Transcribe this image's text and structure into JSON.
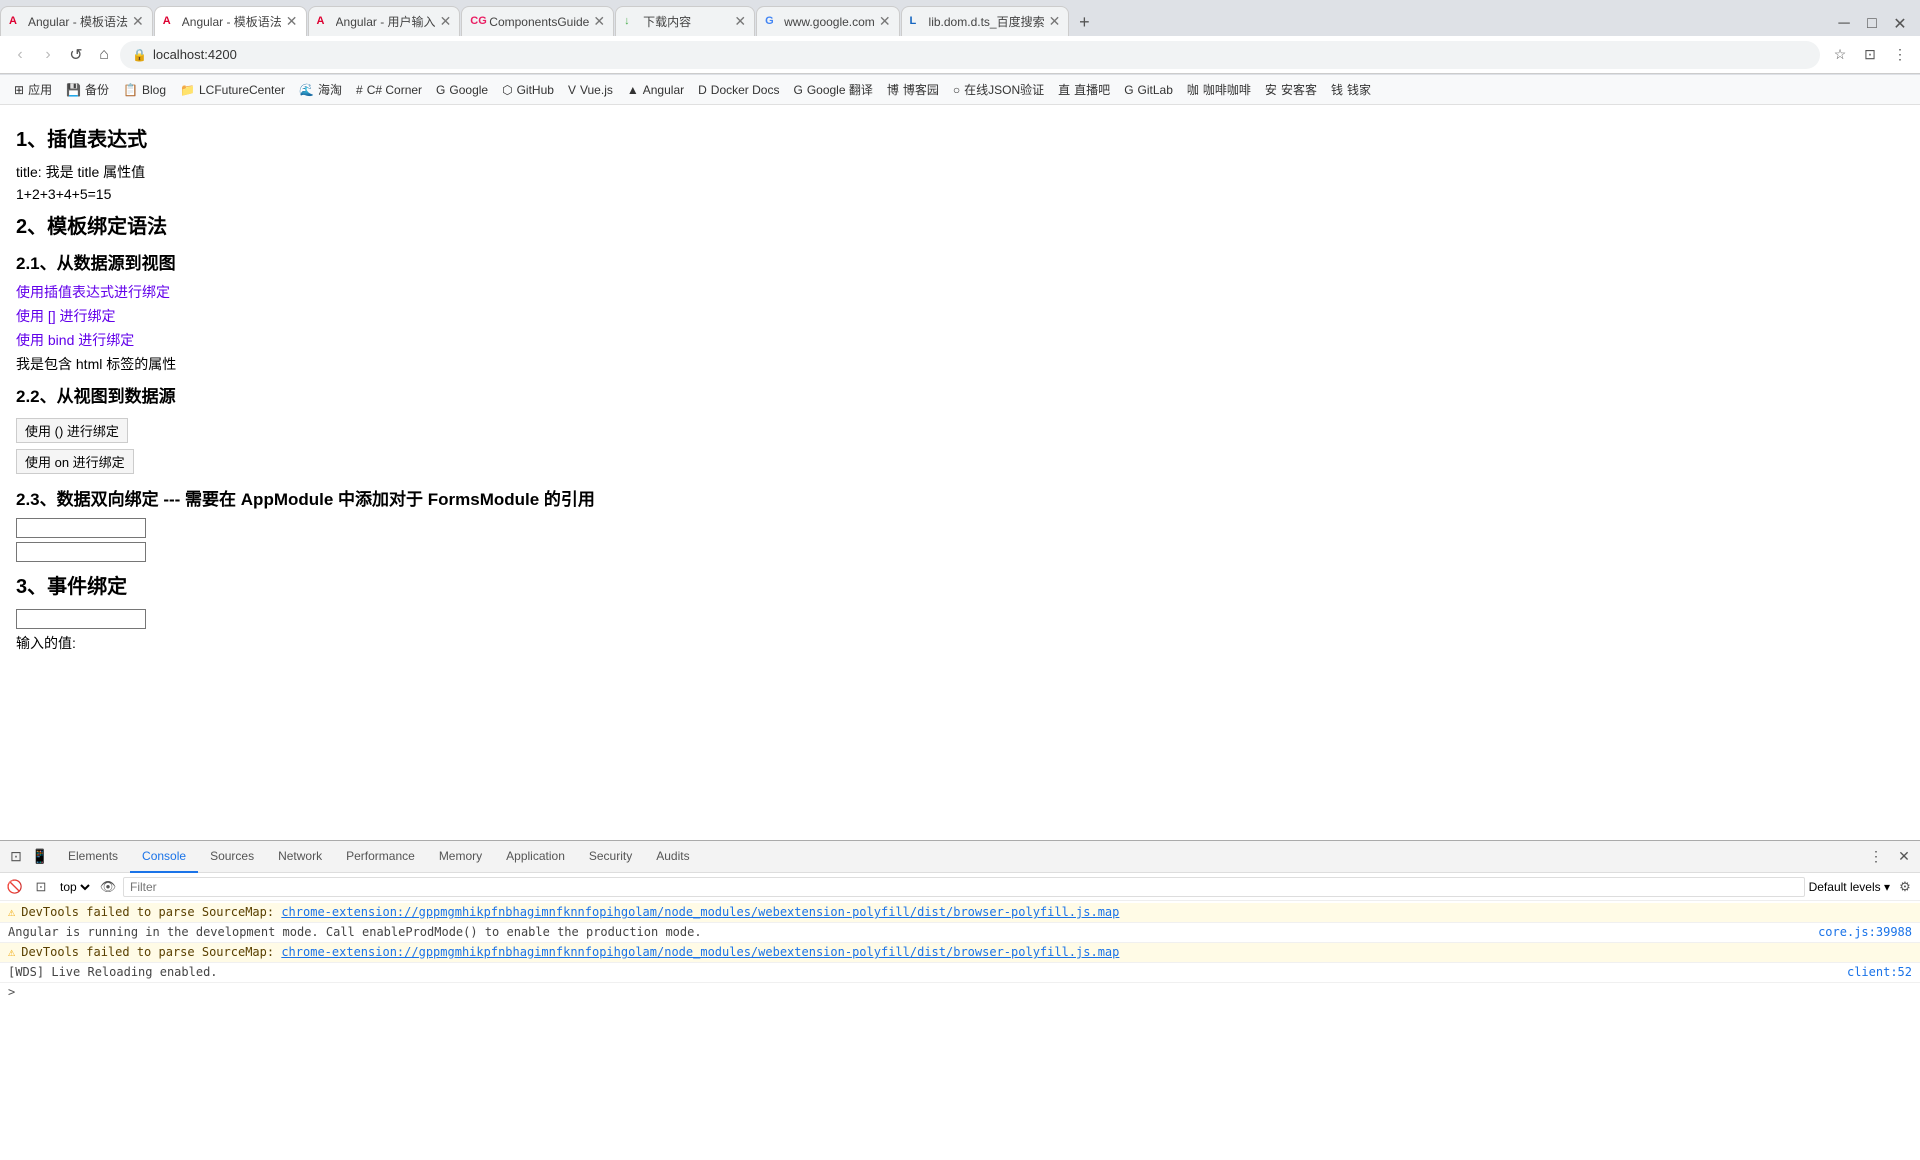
{
  "browser": {
    "tabs": [
      {
        "id": "t1",
        "favicon": "A",
        "title": "Angular - 模板语法",
        "active": false
      },
      {
        "id": "t2",
        "favicon": "A",
        "title": "Angular - 模板语法",
        "active": true
      },
      {
        "id": "t3",
        "favicon": "A",
        "title": "Angular - 用户输入",
        "active": false
      },
      {
        "id": "t4",
        "favicon": "CG",
        "title": "ComponentsGuide",
        "active": false
      },
      {
        "id": "t5",
        "favicon": "↓",
        "title": "下载内容",
        "active": false
      },
      {
        "id": "t6",
        "favicon": "G",
        "title": "www.google.com",
        "active": false
      },
      {
        "id": "t7",
        "favicon": "L",
        "title": "lib.dom.d.ts_百度搜索",
        "active": false
      }
    ],
    "url": "localhost:4200",
    "bookmarks": [
      {
        "icon": "☰",
        "label": "应用"
      },
      {
        "icon": "💾",
        "label": "备份"
      },
      {
        "icon": "📋",
        "label": "Blog"
      },
      {
        "icon": "📁",
        "label": "LCFutureCenter"
      },
      {
        "icon": "🌊",
        "label": "海淘"
      },
      {
        "icon": "#",
        "label": "C# Corner"
      },
      {
        "icon": "G",
        "label": "Google"
      },
      {
        "icon": "⬡",
        "label": "GitHub"
      },
      {
        "icon": "V",
        "label": "Vue.js"
      },
      {
        "icon": "▲",
        "label": "Angular"
      },
      {
        "icon": "D",
        "label": "Docker Docs"
      },
      {
        "icon": "G",
        "label": "Google 翻译"
      },
      {
        "icon": "博",
        "label": "博客园"
      },
      {
        "icon": "○",
        "label": "在线JSON验证"
      },
      {
        "icon": "直",
        "label": "直播吧"
      },
      {
        "icon": "G",
        "label": "GitLab"
      },
      {
        "icon": "咖",
        "label": "咖啡咖啡"
      },
      {
        "icon": "安",
        "label": "安客客"
      },
      {
        "icon": "钱",
        "label": "钱家"
      }
    ]
  },
  "page": {
    "sections": {
      "s1_title": "1、插值表达式",
      "s1_line1": "title: 我是 title 属性值",
      "s1_line2": "1+2+3+4+5=15",
      "s2_title": "2、模板绑定语法",
      "s2_1_title": "2.1、从数据源到视图",
      "s2_1_link1": "使用插值表达式进行绑定",
      "s2_1_link2": "使用 [] 进行绑定",
      "s2_1_link3": "使用 bind 进行绑定",
      "s2_1_text": "我是包含 html 标签的属性",
      "s2_2_title": "2.2、从视图到数据源",
      "s2_2_btn1": "使用 () 进行绑定",
      "s2_2_btn2": "使用 on 进行绑定",
      "s2_3_title": "2.3、数据双向绑定 --- 需要在 AppModule 中添加对于 FormsModule 的引用",
      "s3_title": "3、事件绑定",
      "s3_label": "输入的值:"
    }
  },
  "devtools": {
    "tabs": [
      {
        "label": "Elements"
      },
      {
        "label": "Console",
        "active": true
      },
      {
        "label": "Sources"
      },
      {
        "label": "Network"
      },
      {
        "label": "Performance"
      },
      {
        "label": "Memory"
      },
      {
        "label": "Application"
      },
      {
        "label": "Security"
      },
      {
        "label": "Audits"
      }
    ],
    "toolbar": {
      "context": "top",
      "filter_placeholder": "Filter",
      "levels": "Default levels"
    },
    "console_lines": [
      {
        "type": "warning",
        "text": "DevTools failed to parse SourceMap: chrome-extension://gppmgmhikpfnbhagimnfknnfopihgolam/node_modules/webextension-polyfill/dist/browser-polyfill.js.map",
        "source": ""
      },
      {
        "type": "info",
        "text": "Angular is running in the development mode. Call enableProdMode() to enable the production mode.",
        "source": "core.js:39988"
      },
      {
        "type": "warning",
        "text": "DevTools failed to parse SourceMap: chrome-extension://gppmgmhikpfnbhagimnfknnfopihgolam/node_modules/webextension-polyfill/dist/browser-polyfill.js.map",
        "source": ""
      },
      {
        "type": "info",
        "text": "[WDS] Live Reloading enabled.",
        "source": "client:52"
      }
    ],
    "prompt_symbol": ">"
  }
}
